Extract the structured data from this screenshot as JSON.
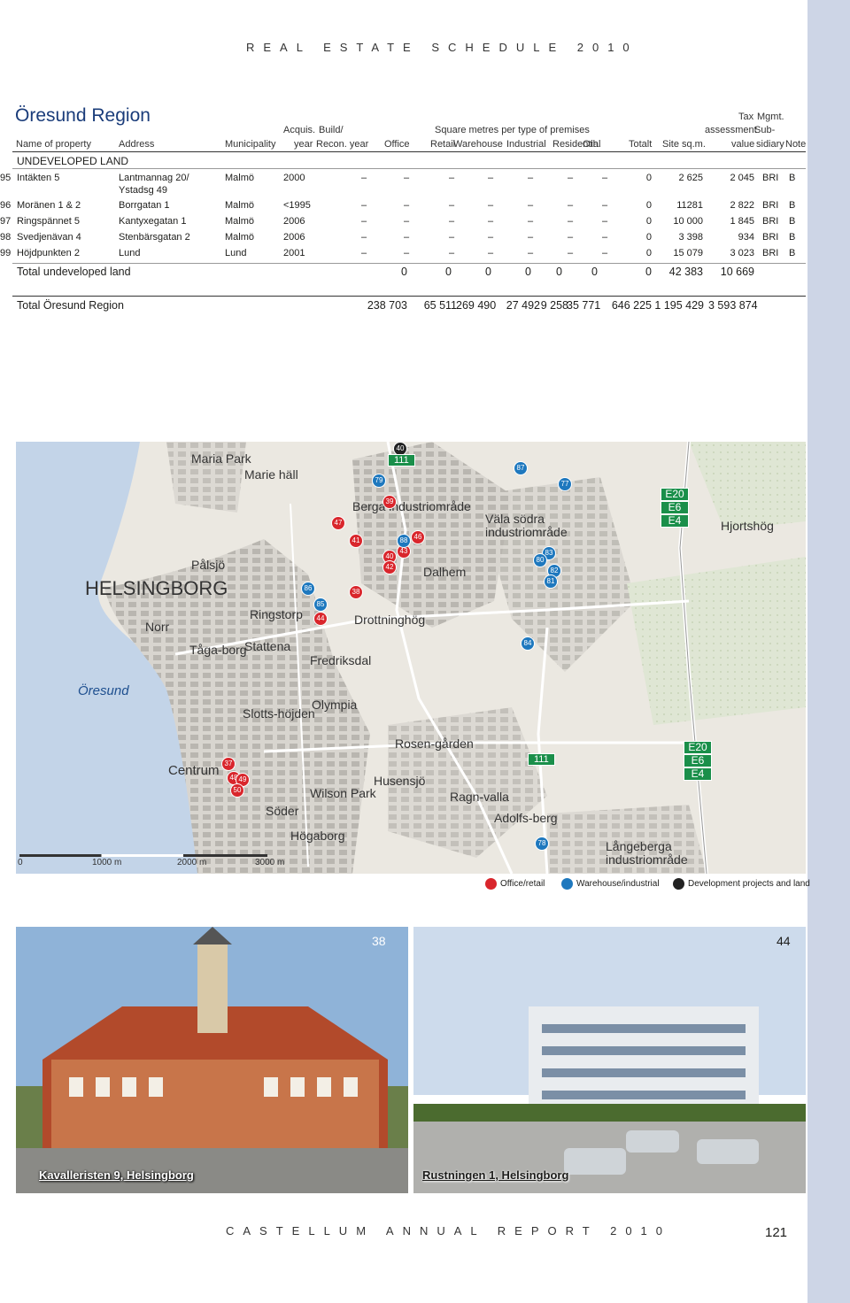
{
  "header": "REAL ESTATE SCHEDULE 2010",
  "footer": {
    "text": "CASTELLUM ANNUAL REPORT 2010",
    "page": "121"
  },
  "region": "Öresund Region",
  "headers": {
    "name": "Name of property",
    "address": "Address",
    "municipality": "Municipality",
    "acquis1": "Acquis.",
    "acquis2": "year",
    "build1": "Build/",
    "build2": "Recon. year",
    "sqm_group": "Square metres per type of premises",
    "office": "Office",
    "retail": "Retail",
    "warehouse": "Warehouse",
    "industrial": "Industrial",
    "residential": "Residential",
    "oth": "Oth.",
    "totalt": "Totalt",
    "site": "Site sq.m.",
    "tax1": "Tax",
    "tax2": "assessment",
    "tax3": "value",
    "mgmt1": "Mgmt.",
    "mgmt2": "Sub-",
    "mgmt3": "sidiary",
    "note": "Note"
  },
  "section_title": "UNDEVELOPED LAND",
  "rows": [
    {
      "no": "95",
      "name": "Intäkten 5",
      "address": "Lantmannag 20/",
      "address2": "Ystadsg 49",
      "municipality": "Malmö",
      "acq": "2000",
      "build": "",
      "dashes": "–",
      "totalt": "0",
      "site": "2 625",
      "tax": "2 045",
      "mgmt": "BRI",
      "note": "B"
    },
    {
      "no": "96",
      "name": "Moränen 1 & 2",
      "address": "Borrgatan 1",
      "address2": "",
      "municipality": "Malmö",
      "acq": "<1995",
      "build": "",
      "dashes": "–",
      "totalt": "0",
      "site": "11281",
      "tax": "2 822",
      "mgmt": "BRI",
      "note": "B"
    },
    {
      "no": "97",
      "name": "Ringspännet 5",
      "address": "Kantyxegatan 1",
      "address2": "",
      "municipality": "Malmö",
      "acq": "2006",
      "build": "",
      "dashes": "–",
      "totalt": "0",
      "site": "10 000",
      "tax": "1 845",
      "mgmt": "BRI",
      "note": "B"
    },
    {
      "no": "98",
      "name": "Svedjenävan 4",
      "address": "Stenbärsgatan 2",
      "address2": "",
      "municipality": "Malmö",
      "acq": "2006",
      "build": "",
      "dashes": "–",
      "totalt": "0",
      "site": "3 398",
      "tax": "934",
      "mgmt": "BRI",
      "note": "B"
    },
    {
      "no": "99",
      "name": "Höjdpunkten 2",
      "address": "Lund",
      "address2": "",
      "municipality": "Lund",
      "acq": "2001",
      "build": "",
      "dashes": "–",
      "totalt": "0",
      "site": "15 079",
      "tax": "3 023",
      "mgmt": "BRI",
      "note": "B"
    }
  ],
  "total_undeveloped": {
    "label": "Total undeveloped land",
    "values": [
      "0",
      "0",
      "0",
      "0",
      "0",
      "0",
      "0",
      "42 383",
      "10 669"
    ]
  },
  "total_region": {
    "label": "Total Öresund Region",
    "values": [
      "238 703",
      "65 511",
      "269 490",
      "27 492",
      "9 258",
      "35 771",
      "646 225",
      "1 195 429",
      "3 593 874"
    ]
  },
  "map": {
    "places": [
      "Maria Park",
      "Marie häll",
      "Berga industriområde",
      "Väla södra industriområde",
      "Hjortshög",
      "Pålsjö",
      "HELSINGBORG",
      "Dalhem",
      "Norr",
      "Ringstorp",
      "Drottninghög",
      "Tåga-borg",
      "Stattena",
      "Fredriksdal",
      "Öresund",
      "Olympia",
      "Slotts-höjden",
      "Rosen-gården",
      "Centrum",
      "Husensjö",
      "Wilson Park",
      "Ragn-valla",
      "Söder",
      "Adolfs-berg",
      "Högaborg",
      "Långeberga industriområde"
    ],
    "markers_red": [
      "47",
      "41",
      "39",
      "40",
      "42",
      "43",
      "46",
      "38",
      "44",
      "37",
      "48",
      "49",
      "50"
    ],
    "markers_blue": [
      "87",
      "77",
      "83",
      "80",
      "82",
      "81",
      "84",
      "85",
      "86",
      "88",
      "79",
      "78"
    ],
    "markers_black": [
      "40"
    ],
    "road_labels": [
      "111",
      "111"
    ],
    "shields": [
      "E20",
      "E6",
      "E4"
    ],
    "scale": [
      "0",
      "1000 m",
      "2000 m",
      "3000 m"
    ]
  },
  "legend": [
    {
      "label": "Office/retail",
      "color": "#d9262c"
    },
    {
      "label": "Warehouse/industrial",
      "color": "#1e78be"
    },
    {
      "label": "Development projects and land",
      "color": "#222222"
    }
  ],
  "photos": [
    {
      "caption": "Kavalleristen 9, Helsingborg",
      "number": "38"
    },
    {
      "caption": "Rustningen 1, Helsingborg",
      "number": "44"
    }
  ]
}
